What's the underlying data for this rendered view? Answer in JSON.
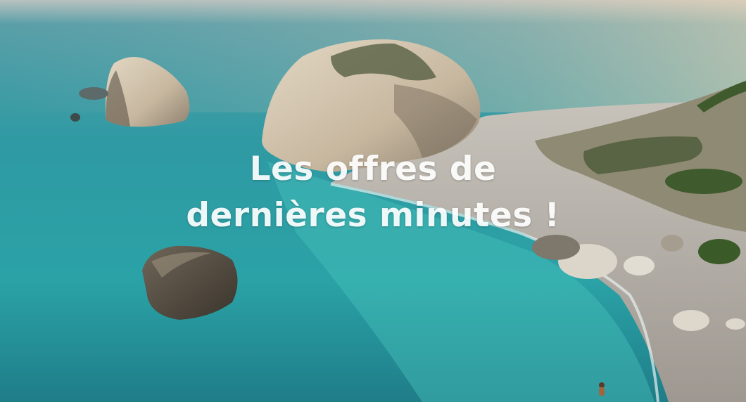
{
  "hero": {
    "headline_line1": "Les offres de",
    "headline_line2": "dernières minutes !",
    "image_subject": "sea-stacks-coastline-photo"
  },
  "colors": {
    "sea_deep": "#1f7f8c",
    "sea_light": "#3fb3b3",
    "horizon": "#c9c0b0",
    "beach": "#b8b4ad",
    "rock": "#c8bba6",
    "text": "#ffffff"
  }
}
